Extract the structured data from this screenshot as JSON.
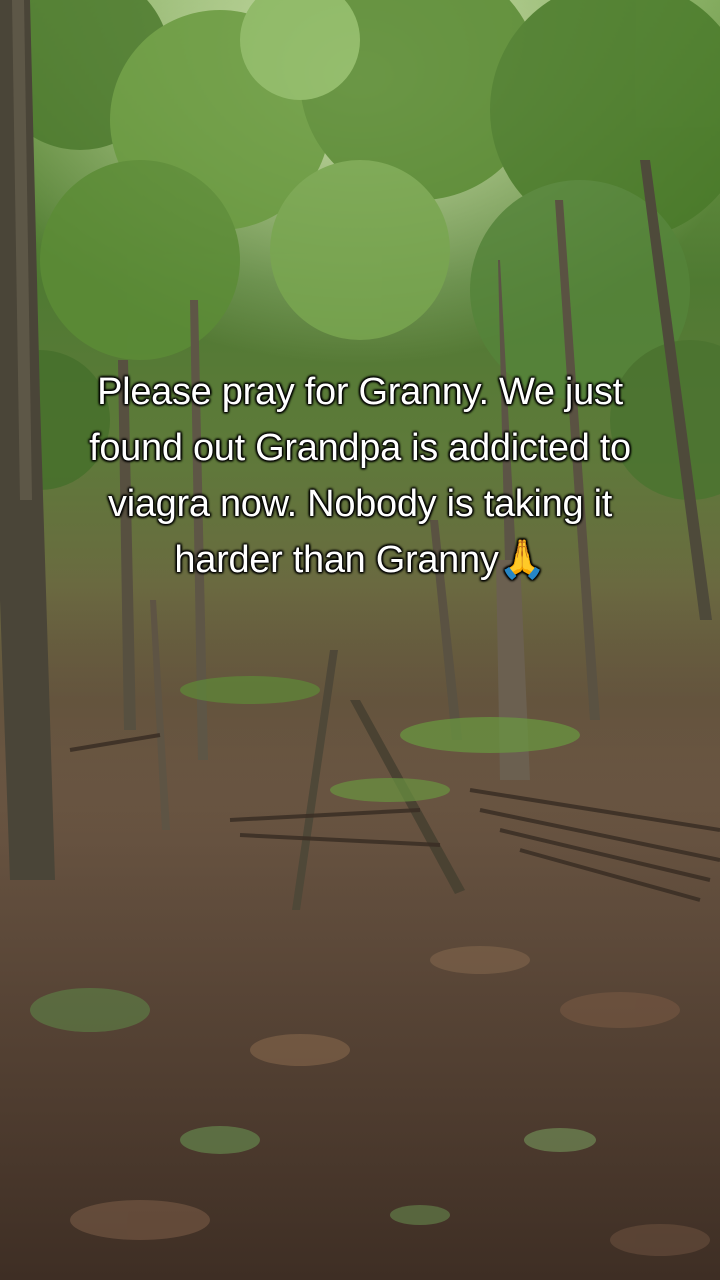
{
  "caption": {
    "text": "Please pray for Granny. We just found out Grandpa is addicted to viagra now. Nobody is taking it harder than Granny🙏"
  },
  "colors": {
    "caption_text": "#ffffff",
    "canopy": "#5f8a3c",
    "forest_floor": "#5a4a3a"
  }
}
